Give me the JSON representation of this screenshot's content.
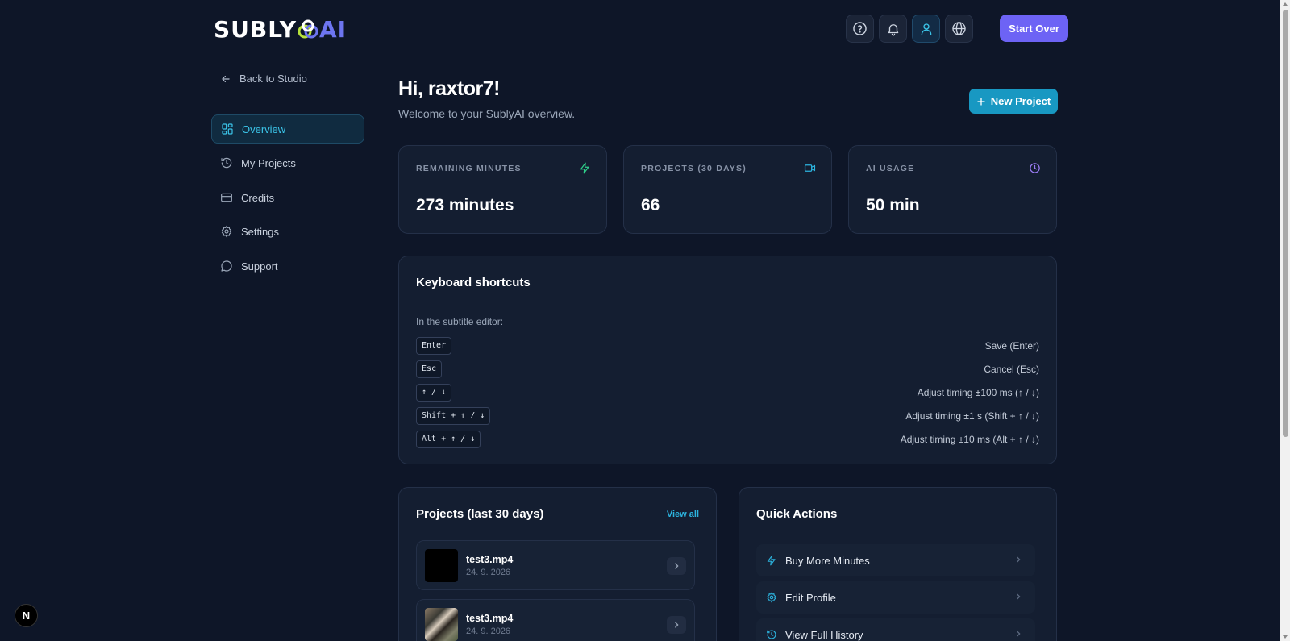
{
  "app": {
    "logo_part1": "SUBLY",
    "logo_part2": "AI",
    "start_over": "Start Over"
  },
  "header_icons": [
    "help-icon",
    "bell-icon",
    "user-icon",
    "globe-icon"
  ],
  "sidebar": {
    "back": "Back to Studio",
    "items": [
      {
        "label": "Overview",
        "icon": "overview-grid-icon",
        "active": true
      },
      {
        "label": "My Projects",
        "icon": "history-icon",
        "active": false
      },
      {
        "label": "Credits",
        "icon": "credit-card-icon",
        "active": false
      },
      {
        "label": "Settings",
        "icon": "gear-icon",
        "active": false
      },
      {
        "label": "Support",
        "icon": "chat-bubble-icon",
        "active": false
      }
    ]
  },
  "main": {
    "greeting": "Hi, raxtor7!",
    "subtitle": "Welcome to your SublyAI overview.",
    "new_project": "New Project",
    "stats": [
      {
        "label": "REMAINING MINUTES",
        "value": "273 minutes",
        "icon": "lightning-icon",
        "color": "#2fd08a"
      },
      {
        "label": "PROJECTS (30 DAYS)",
        "value": "66",
        "icon": "video-camera-icon",
        "color": "#2cb4df"
      },
      {
        "label": "AI USAGE",
        "value": "50 min",
        "icon": "clock-icon",
        "color": "#9b7cf5"
      }
    ],
    "shortcuts": {
      "title": "Keyboard shortcuts",
      "intro": "In the subtitle editor:",
      "rows": [
        {
          "key": "Enter",
          "desc": "Save (Enter)"
        },
        {
          "key": "Esc",
          "desc": "Cancel (Esc)"
        },
        {
          "key": "↑ / ↓",
          "desc": "Adjust timing ±100 ms (↑ / ↓)"
        },
        {
          "key": "Shift + ↑ / ↓",
          "desc": "Adjust timing ±1 s (Shift + ↑ / ↓)"
        },
        {
          "key": "Alt + ↑ / ↓",
          "desc": "Adjust timing ±10 ms (Alt + ↑ / ↓)"
        }
      ]
    },
    "projects": {
      "title": "Projects (last 30 days)",
      "view_all": "View all",
      "items": [
        {
          "name": "test3.mp4",
          "date": "24. 9. 2026"
        },
        {
          "name": "test3.mp4",
          "date": "24. 9. 2026"
        }
      ]
    },
    "quick_actions": {
      "title": "Quick Actions",
      "items": [
        {
          "label": "Buy More Minutes",
          "icon": "lightning-icon"
        },
        {
          "label": "Edit Profile",
          "icon": "gear-icon"
        },
        {
          "label": "View Full History",
          "icon": "history-icon"
        }
      ]
    }
  },
  "devtools_badge": "N"
}
